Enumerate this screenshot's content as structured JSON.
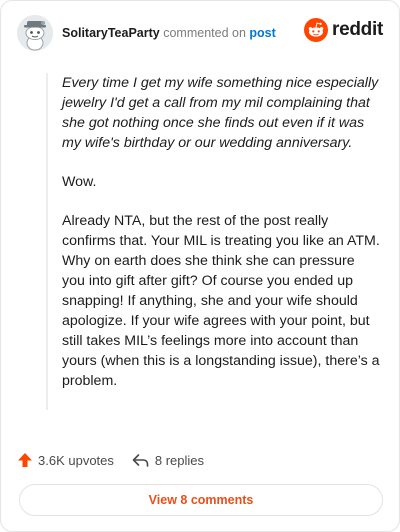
{
  "header": {
    "username": "SolitaryTeaParty",
    "commented_text": "commented on",
    "post_link": "post",
    "brand": "reddit"
  },
  "comment": {
    "quote": "Every time I get my wife something nice especially jewelry I'd get a call from my mil complaining that she got nothing once she finds out even if it was my wife's birthday or our wedding anniversary.",
    "paragraph_2": "Wow.",
    "paragraph_3": "Already NTA, but the rest of the post really confirms that. Your MIL is treating you like an ATM. Why on earth does she think she can pressure you into gift after gift? Of course you ended up snapping! If anything, she and your wife should apologize. If your wife agrees with your point, but still takes MIL’s feelings more into account than yours (when this is a longstanding issue), there’s a problem."
  },
  "footer": {
    "upvotes": "3.6K upvotes",
    "replies": "8 replies",
    "view_comments": "View 8 comments"
  },
  "colors": {
    "brand_orange": "#ff4500",
    "link_blue": "#0079d3",
    "view_text": "#e8501b"
  },
  "icons": [
    "snoo-avatar-icon",
    "reddit-logo-icon",
    "upvote-arrow-icon",
    "reply-arrow-icon"
  ]
}
